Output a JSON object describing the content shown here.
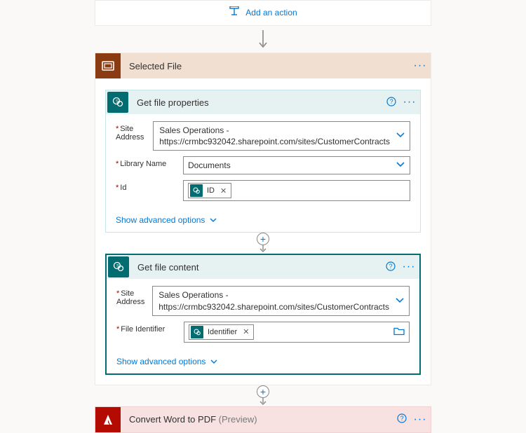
{
  "addAction": "Add an action",
  "scope": {
    "title": "Selected File"
  },
  "getProps": {
    "title": "Get file properties",
    "siteAddressLabel": "Site Address",
    "siteAddress_line1": "Sales Operations -",
    "siteAddress_line2": "https://crmbc932042.sharepoint.com/sites/CustomerContracts",
    "libraryLabel": "Library Name",
    "library": "Documents",
    "idLabel": "Id",
    "idToken": "ID",
    "advanced": "Show advanced options"
  },
  "getContent": {
    "title": "Get file content",
    "siteAddressLabel": "Site Address",
    "siteAddress_line1": "Sales Operations -",
    "siteAddress_line2": "https://crmbc932042.sharepoint.com/sites/CustomerContracts",
    "fileIdLabel": "File Identifier",
    "fileIdToken": "Identifier",
    "advanced": "Show advanced options"
  },
  "adobe": {
    "title": "Convert Word to PDF ",
    "preview": "(Preview)"
  }
}
